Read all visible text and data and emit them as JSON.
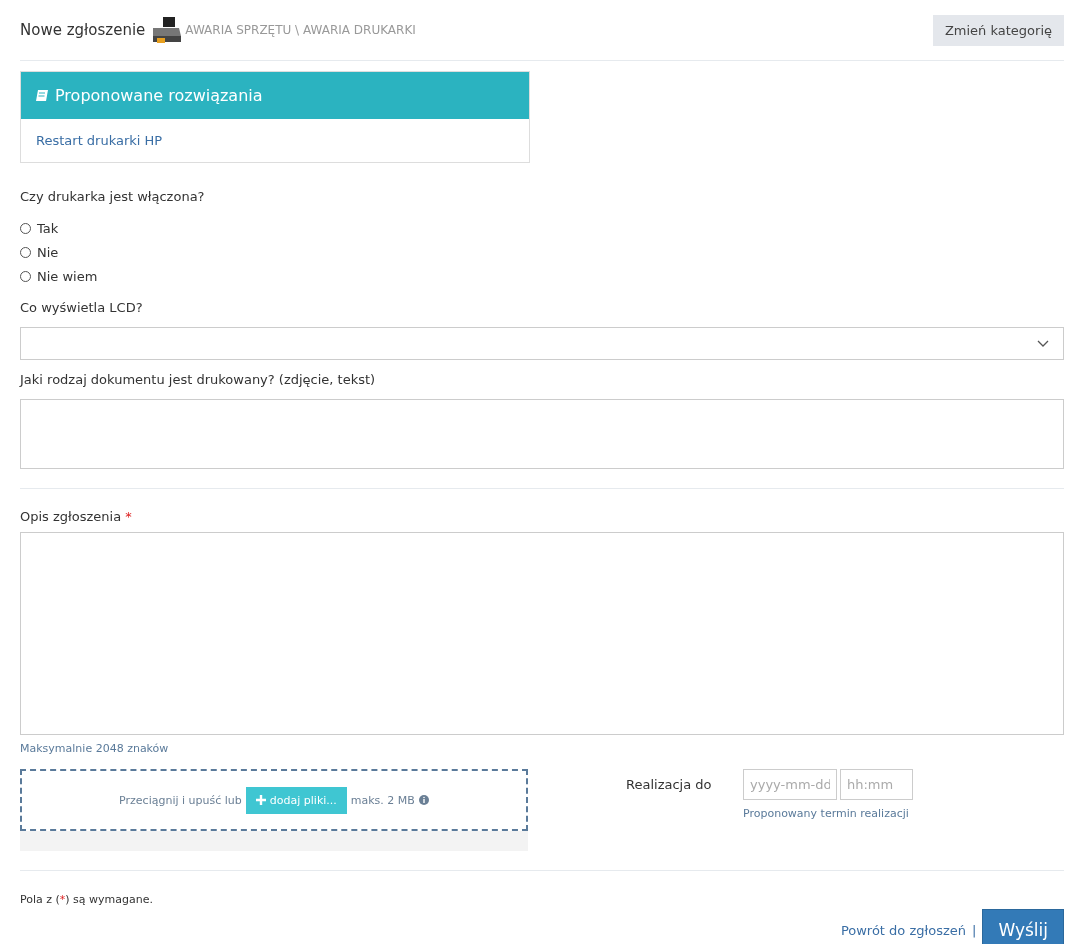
{
  "header": {
    "title": "Nowe zgłoszenie",
    "category_path": "AWARIA SPRZĘTU \\ AWARIA DRUKARKI",
    "change_button": "Zmień kategorię"
  },
  "solutions": {
    "title": "Proponowane rozwiązania",
    "links": [
      "Restart drukarki HP"
    ]
  },
  "questions": [
    {
      "kind": "radio",
      "label": "Czy drukarka jest włączona?",
      "options": [
        {
          "label": "Tak",
          "selected": false
        },
        {
          "label": "Nie",
          "selected": false
        },
        {
          "label": "Nie wiem",
          "selected": false
        }
      ]
    },
    {
      "kind": "select",
      "label": "Co wyświetla LCD?"
    },
    {
      "kind": "textarea",
      "label": "Jaki rodzaj dokumentu jest drukowany? (zdjęcie, tekst)"
    }
  ],
  "description": {
    "label": "Opis zgłoszenia",
    "required_mark": "*",
    "hint": "Maksymalnie 2048 znaków"
  },
  "upload": {
    "prefix": "Przeciągnij i upuść lub",
    "button": "dodaj pliki...",
    "limit": "maks. 2 MB"
  },
  "deadline": {
    "label": "Realizacja do",
    "date_placeholder": "yyyy-mm-dd",
    "time_placeholder": "hh:mm",
    "hint": "Proponowany termin realizacji"
  },
  "footer": {
    "note_prefix": "Pola z (",
    "note_mark": "*",
    "note_suffix": ") są wymagane.",
    "back_link": "Powrót do zgłoszeń",
    "separator": "|",
    "submit": "Wyślij"
  }
}
